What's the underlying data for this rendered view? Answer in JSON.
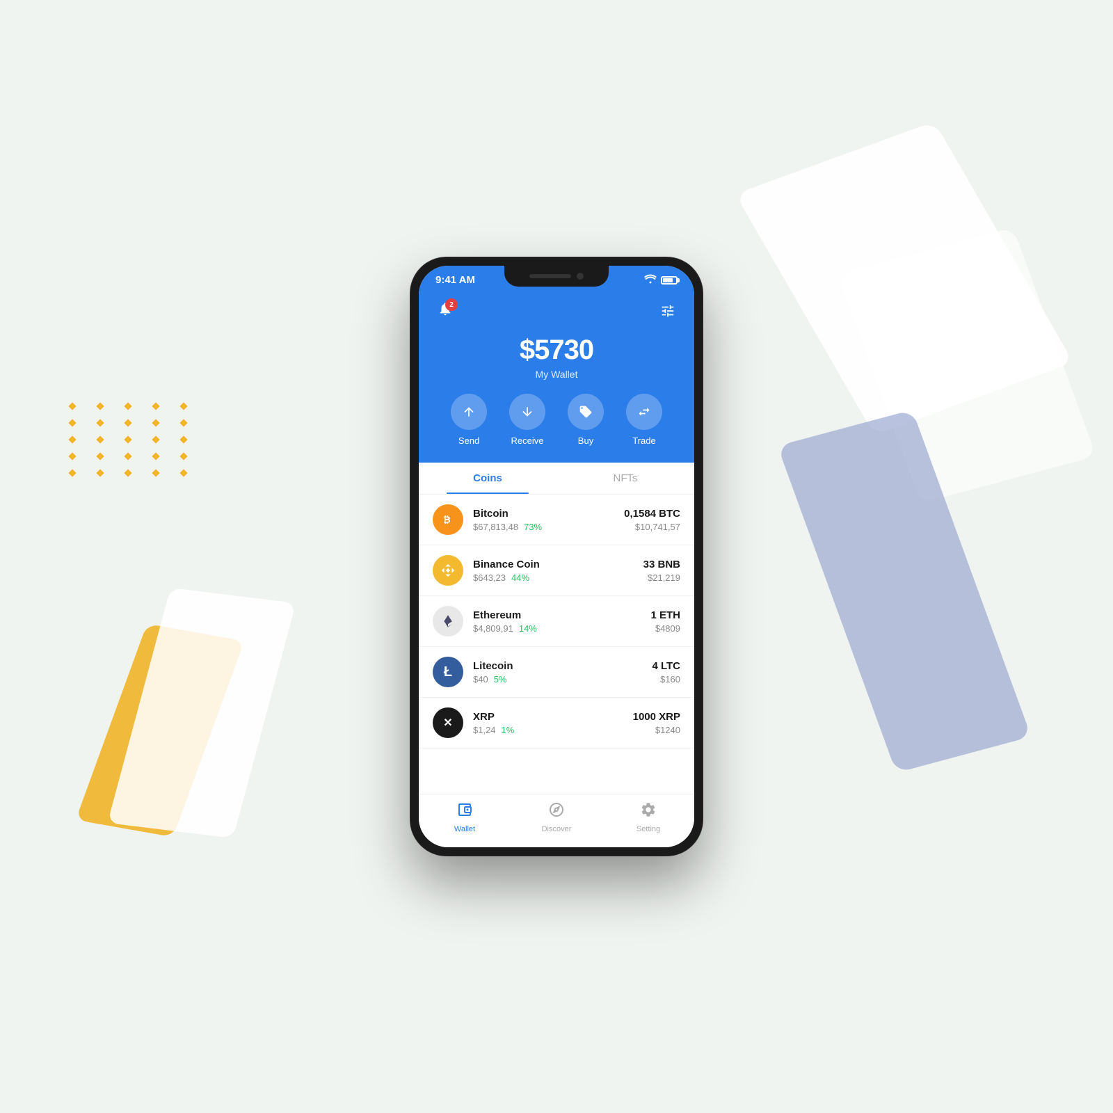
{
  "meta": {
    "bg_color": "#f0f4f0"
  },
  "status_bar": {
    "time": "9:41 AM",
    "wifi": "wifi",
    "battery": "battery"
  },
  "header": {
    "notification_count": "2",
    "balance_amount": "$5730",
    "balance_label": "My Wallet"
  },
  "actions": [
    {
      "id": "send",
      "label": "Send",
      "icon": "↑"
    },
    {
      "id": "receive",
      "label": "Receive",
      "icon": "↓"
    },
    {
      "id": "buy",
      "label": "Buy",
      "icon": "🏷"
    },
    {
      "id": "trade",
      "label": "Trade",
      "icon": "⇄"
    }
  ],
  "tabs": [
    {
      "id": "coins",
      "label": "Coins",
      "active": true
    },
    {
      "id": "nfts",
      "label": "NFTs",
      "active": false
    }
  ],
  "coins": [
    {
      "id": "btc",
      "name": "Bitcoin",
      "price": "$67,813,48",
      "change": "73%",
      "amount": "0,1584 BTC",
      "value": "$10,741,57",
      "logo_text": "₿",
      "logo_class": "btc"
    },
    {
      "id": "bnb",
      "name": "Binance Coin",
      "price": "$643,23",
      "change": "44%",
      "amount": "33 BNB",
      "value": "$21,219",
      "logo_text": "◆",
      "logo_class": "bnb"
    },
    {
      "id": "eth",
      "name": "Ethereum",
      "price": "$4,809,91",
      "change": "14%",
      "amount": "1 ETH",
      "value": "$4809",
      "logo_text": "⬡",
      "logo_class": "eth"
    },
    {
      "id": "ltc",
      "name": "Litecoin",
      "price": "$40",
      "change": "5%",
      "amount": "4 LTC",
      "value": "$160",
      "logo_text": "Ł",
      "logo_class": "ltc"
    },
    {
      "id": "xrp",
      "name": "XRP",
      "price": "$1,24",
      "change": "1%",
      "amount": "1000 XRP",
      "value": "$1240",
      "logo_text": "✕",
      "logo_class": "xrp"
    }
  ],
  "bottom_nav": [
    {
      "id": "wallet",
      "label": "Wallet",
      "active": true,
      "icon": "wallet"
    },
    {
      "id": "discover",
      "label": "Discover",
      "active": false,
      "icon": "compass"
    },
    {
      "id": "setting",
      "label": "Setting",
      "active": false,
      "icon": "gear"
    }
  ]
}
